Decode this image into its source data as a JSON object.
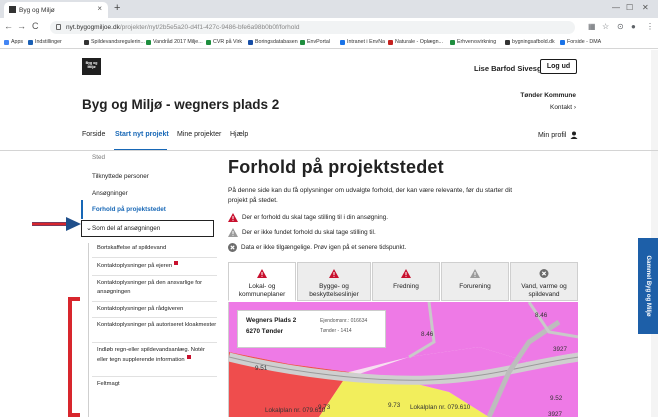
{
  "browser": {
    "tab_title": "Byg og Miljø",
    "url_host": "nyt.bygogmiljoe.dk",
    "url_path": "/projekter/nyt/2b5e5a20-d4f1-427c-9486-bfe6a98b0b0f/forhold",
    "bookmarks": [
      {
        "label": "Apps",
        "color": "#4285f4"
      },
      {
        "label": "Indstillinger",
        "color": "#1a5fb4"
      },
      {
        "label": "Spildevandsregulerin...",
        "color": "#333333"
      },
      {
        "label": "Vandråd 2017 Milje...",
        "color": "#1e8e3e"
      },
      {
        "label": "CVR på Virk",
        "color": "#1e8e3e"
      },
      {
        "label": "Boringsdatabasen",
        "color": "#174ea6"
      },
      {
        "label": "EnvPortal",
        "color": "#1e8e3e"
      },
      {
        "label": "Intranet i EnvNa",
        "color": "#1a73e8"
      },
      {
        "label": "Naturale - Oplægn...",
        "color": "#c5221f"
      },
      {
        "label": "Erhvervsvirkning",
        "color": "#1e8e3e"
      },
      {
        "label": "bygningsafbold.dk",
        "color": "#333333"
      },
      {
        "label": "Forside - DMA",
        "color": "#1a73e8"
      }
    ]
  },
  "header": {
    "logo_text": "Byg og Miljø",
    "user_name": "Lise Barfod Sivesgaard",
    "logout_label": "Log ud",
    "page_title": "Byg og Miljø - wegners plads 2",
    "municipality": "Tønder Kommune",
    "contact_label": "Kontakt ›"
  },
  "nav": {
    "items": [
      "Forside",
      "Start nyt projekt",
      "Mine projekter",
      "Hjælp"
    ],
    "profile_label": "Min profil"
  },
  "sidebar": {
    "items": [
      "Sted",
      "Tilknyttede personer",
      "Ansøgninger",
      "Forhold på projektstedet"
    ],
    "group_label": "Som del af ansøgningen",
    "sub_items": [
      {
        "label": "Bortskaffelse af spildevand",
        "required": false
      },
      {
        "label": "Kontaktoplysninger på ejeren",
        "required": true
      },
      {
        "label": "Kontaktoplysninger på den ansvarlige for ansøgningen",
        "required": false
      },
      {
        "label": "Kontaktoplysninger på rådgiveren",
        "required": false
      },
      {
        "label": "Kontaktoplysninger på autoriseret kloakmester",
        "required": false
      },
      {
        "label": "Indløb regn-eller spildevandsanlæg. Notér eller tegn supplerende information",
        "required": true
      },
      {
        "label": "Feltmagt",
        "required": false
      }
    ]
  },
  "main": {
    "heading": "Forhold på projektstedet",
    "intro": "På denne side kan du få oplysninger om udvalgte forhold, der kan være relevante, før du starter dit projekt på stedet.",
    "legend": [
      {
        "text": "Der er forhold du skal tage stilling til i din ansøgning.",
        "icon": "warning-red-icon",
        "color": "#c8102e"
      },
      {
        "text": "Der er ikke fundet forhold du skal tage stilling til.",
        "icon": "warning-gray-icon",
        "color": "#9a9a9a"
      },
      {
        "text": "Data er ikke tilgængelige. Prøv igen på et senere tidspunkt.",
        "icon": "unavailable-icon",
        "color": "#6d6d6d"
      }
    ],
    "tabs": [
      {
        "label": "Lokal- og kommuneplaner",
        "status": "warning-red"
      },
      {
        "label": "Bygge- og beskyttelseslinjer",
        "status": "warning-red"
      },
      {
        "label": "Fredning",
        "status": "warning-red"
      },
      {
        "label": "Forurening",
        "status": "warning-gray"
      },
      {
        "label": "Vand, varme og spildevand",
        "status": "unavailable"
      }
    ]
  },
  "map": {
    "address": "Wegners Plads 2",
    "city": "6270 Tønder",
    "property_label": "Ejendomsnr.: 016634",
    "area_label": "Tønder - 1414",
    "labels": [
      "8.46",
      "8.46",
      "3927",
      "9.51",
      "9.73",
      "9.73",
      "Lokalplan nr. 079.610",
      "Lokalplan nr. 079.610",
      "9.52",
      "3927"
    ]
  },
  "side_tab": {
    "label": "Gammel Byg og Miljø"
  },
  "colors": {
    "accent": "#1767b6",
    "warning": "#c8102e",
    "map_magenta": "#ee7ae6",
    "map_red": "#ef4d4d",
    "map_yellow": "#f2ee5c"
  }
}
